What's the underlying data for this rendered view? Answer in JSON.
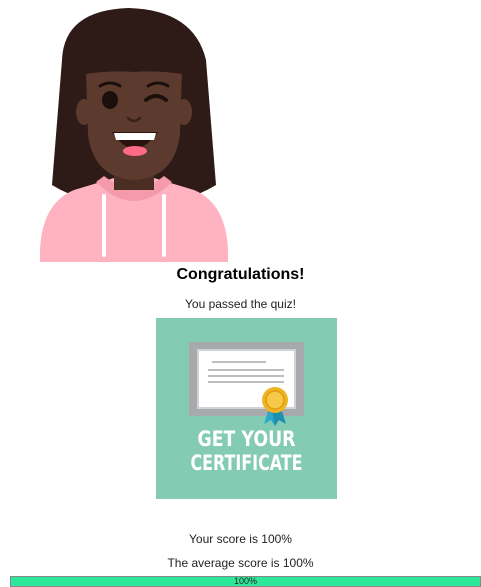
{
  "result": {
    "heading": "Congratulations!",
    "subheading": "You passed the quiz!",
    "score_text": "Your score is 100%",
    "average_text": "The average score is 100%"
  },
  "certificate": {
    "line1": "GET YOUR",
    "line2": "CERTIFICATE",
    "background_color": "#84cbb3"
  },
  "progress": {
    "value_percent": 100,
    "label": "100%",
    "fill_color": "#2ee89a"
  },
  "avatar": {
    "icon": "winking-girl-avatar-icon"
  }
}
